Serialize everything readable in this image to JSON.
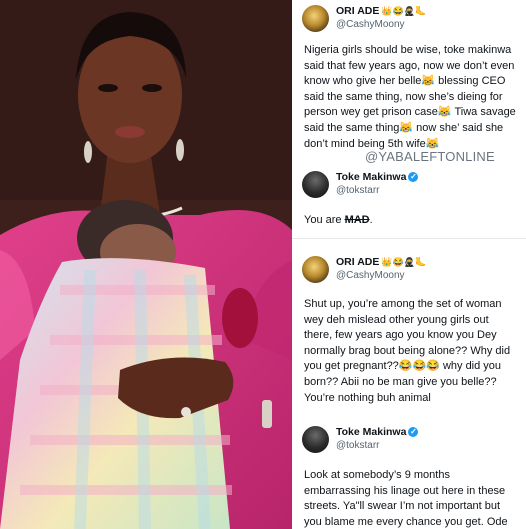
{
  "watermark": "@YABALEFTONLINE",
  "tweets": [
    {
      "display_name": "ORI ADE",
      "emojis": "👑😂🥷🦶",
      "handle": "@CashyMoony",
      "text": "Nigeria girls should be wise, toke makinwa said that few years ago, now we don’t even know who give her belle😹 blessing CEO said the same thing, now she’s dieing for person wey get prison case😹 Tiwa savage said the same thing😹 now she’ said she don’t mind being 5th wife😹"
    },
    {
      "display_name": "Toke Makinwa",
      "verified": "✓",
      "handle": "@tokstarr",
      "text_prefix": "You are ",
      "text_struck": "MAD",
      "text_suffix": "."
    },
    {
      "display_name": "ORI ADE",
      "emojis": "👑😂🥷🦶",
      "handle": "@CashyMoony",
      "text": "Shut up, you’re among the set of woman wey deh mislead other young girls out there, few years ago you know you Dey normally brag bout being alone?? Why did you get pregnant??😂😂😂 why did you born?? Abii no be man give you belle?? You’re nothing buh animal"
    },
    {
      "display_name": "Toke Makinwa",
      "verified": "✓",
      "handle": "@tokstarr",
      "text": "Look at somebody’s 9 months embarrassing his linage out here in these streets. Ya\"ll swear I’m not important but you blame me every chance you get. Ode"
    }
  ]
}
